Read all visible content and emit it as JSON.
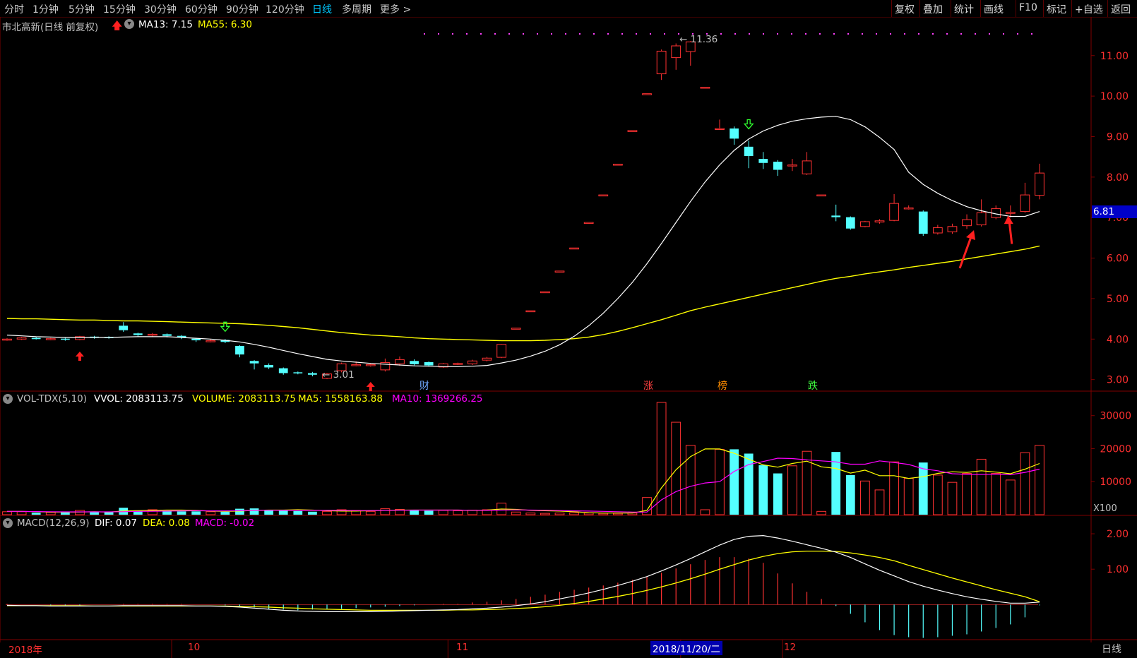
{
  "toolbar": {
    "periods": [
      "分时",
      "1分钟",
      "5分钟",
      "15分钟",
      "30分钟",
      "60分钟",
      "90分钟",
      "120分钟",
      "日线",
      "多周期",
      "更多 >"
    ],
    "active_period": "日线",
    "tools": [
      "复权",
      "叠加",
      "统计",
      "画线",
      "F10",
      "标记",
      "+自选",
      "返回"
    ]
  },
  "colors": {
    "up": "#ff3232",
    "down": "#54ffff",
    "ma13": "#ffffff",
    "ma55": "#ffff00",
    "ma10": "#ff00ff",
    "grid": "#7f0000",
    "price_box": "#0000c8"
  },
  "main_header": {
    "stock": "市北高新(日线 前复权)",
    "ma13_label": "MA13: 7.15",
    "ma55_label": "MA55: 6.30"
  },
  "vol_header": {
    "name": "VOL-TDX(5,10)",
    "vvol": "VVOL: 2083113.75",
    "volume": "VOLUME: 2083113.75",
    "ma5": "MA5: 1558163.88",
    "ma10": "MA10: 1369266.25",
    "unit": "X100"
  },
  "macd_header": {
    "name": "MACD(12,26,9)",
    "dif": "DIF: 0.07",
    "dea": "DEA: 0.08",
    "macd": "MACD: -0.02"
  },
  "annotations": {
    "high": "11.36",
    "low": "3.01",
    "current_price": "6.81"
  },
  "events": [
    "财",
    "涨",
    "榜",
    "跌"
  ],
  "bottom_axis": {
    "labels": [
      "2018年",
      "10",
      "11",
      "2018/11/20/二",
      "12"
    ],
    "period": "日线"
  },
  "chart_data": [
    {
      "type": "candlestick",
      "title": "市北高新(日线 前复权)",
      "y_ticks": [
        "11.00",
        "10.00",
        "9.00",
        "8.00",
        "7.00",
        "6.00",
        "5.00",
        "4.00",
        "3.00"
      ],
      "ylim": [
        2.75,
        11.85
      ],
      "candles": [
        [
          3.98,
          4.0,
          3.96,
          4.02
        ],
        [
          4.0,
          4.03,
          3.98,
          4.05
        ],
        [
          4.03,
          4.0,
          3.99,
          4.05
        ],
        [
          4.0,
          4.01,
          3.97,
          4.03
        ],
        [
          4.01,
          3.99,
          3.96,
          4.03
        ],
        [
          3.99,
          4.06,
          3.97,
          4.08
        ],
        [
          4.06,
          4.05,
          4.01,
          4.08
        ],
        [
          4.05,
          4.04,
          4.01,
          4.07
        ],
        [
          4.33,
          4.22,
          4.18,
          4.42
        ],
        [
          4.14,
          4.1,
          4.05,
          4.16
        ],
        [
          4.1,
          4.12,
          4.06,
          4.15
        ],
        [
          4.12,
          4.08,
          4.04,
          4.14
        ],
        [
          4.08,
          4.04,
          4.0,
          4.1
        ],
        [
          4.01,
          3.97,
          3.93,
          4.03
        ],
        [
          3.94,
          3.96,
          3.92,
          4.0
        ],
        [
          3.98,
          3.93,
          3.9,
          4.0
        ],
        [
          3.83,
          3.62,
          3.55,
          3.85
        ],
        [
          3.46,
          3.4,
          3.25,
          3.48
        ],
        [
          3.36,
          3.3,
          3.26,
          3.4
        ],
        [
          3.28,
          3.16,
          3.12,
          3.3
        ],
        [
          3.18,
          3.17,
          3.13,
          3.2
        ],
        [
          3.16,
          3.12,
          3.08,
          3.19
        ],
        [
          3.03,
          3.14,
          3.01,
          3.16
        ],
        [
          3.22,
          3.39,
          3.18,
          3.42
        ],
        [
          3.36,
          3.37,
          3.33,
          3.45
        ],
        [
          3.35,
          3.37,
          3.32,
          3.39
        ],
        [
          3.24,
          3.42,
          3.2,
          3.52
        ],
        [
          3.39,
          3.49,
          3.34,
          3.57
        ],
        [
          3.46,
          3.38,
          3.35,
          3.5
        ],
        [
          3.43,
          3.35,
          3.32,
          3.45
        ],
        [
          3.31,
          3.39,
          3.29,
          3.41
        ],
        [
          3.38,
          3.4,
          3.36,
          3.42
        ],
        [
          3.39,
          3.46,
          3.36,
          3.49
        ],
        [
          3.48,
          3.53,
          3.45,
          3.56
        ],
        [
          3.55,
          3.87,
          3.53,
          3.88
        ],
        [
          4.27,
          4.27,
          4.27,
          4.27
        ],
        [
          4.7,
          4.7,
          4.7,
          4.7
        ],
        [
          5.17,
          5.17,
          5.17,
          5.17
        ],
        [
          5.68,
          5.68,
          5.68,
          5.68
        ],
        [
          6.25,
          6.25,
          6.25,
          6.25
        ],
        [
          6.88,
          6.88,
          6.88,
          6.88
        ],
        [
          7.56,
          7.56,
          7.56,
          7.56
        ],
        [
          8.32,
          8.32,
          8.32,
          8.32
        ],
        [
          9.15,
          9.15,
          9.15,
          9.15
        ],
        [
          10.06,
          10.06,
          10.06,
          10.06
        ],
        [
          10.55,
          11.11,
          10.4,
          11.15
        ],
        [
          10.95,
          11.24,
          10.65,
          11.3
        ],
        [
          11.1,
          11.34,
          10.75,
          11.36
        ],
        [
          10.22,
          10.22,
          10.22,
          10.22
        ],
        [
          9.2,
          9.2,
          9.2,
          9.42
        ],
        [
          9.2,
          8.95,
          8.8,
          9.25
        ],
        [
          8.75,
          8.52,
          8.22,
          8.9
        ],
        [
          8.45,
          8.35,
          8.2,
          8.62
        ],
        [
          8.38,
          8.18,
          8.03,
          8.42
        ],
        [
          8.3,
          8.3,
          8.15,
          8.45
        ],
        [
          8.08,
          8.4,
          8.05,
          8.62
        ],
        [
          7.56,
          7.56,
          7.56,
          7.56
        ],
        [
          7.05,
          7.01,
          6.91,
          7.32
        ],
        [
          7.01,
          6.73,
          6.7,
          7.03
        ],
        [
          6.78,
          6.9,
          6.76,
          6.92
        ],
        [
          6.89,
          6.92,
          6.85,
          6.96
        ],
        [
          6.93,
          7.35,
          6.91,
          7.58
        ],
        [
          7.22,
          7.24,
          7.2,
          7.3
        ],
        [
          7.15,
          6.6,
          6.55,
          7.18
        ],
        [
          6.62,
          6.75,
          6.58,
          6.82
        ],
        [
          6.65,
          6.78,
          6.6,
          6.85
        ],
        [
          6.8,
          6.95,
          6.72,
          7.08
        ],
        [
          6.82,
          7.12,
          6.78,
          7.45
        ],
        [
          7.0,
          7.22,
          6.96,
          7.3
        ],
        [
          7.11,
          7.13,
          7.0,
          7.3
        ],
        [
          7.15,
          7.56,
          7.12,
          7.86
        ],
        [
          7.55,
          8.1,
          7.45,
          8.33
        ]
      ],
      "ma13": [
        4.1,
        4.08,
        4.06,
        4.05,
        4.04,
        4.04,
        4.04,
        4.04,
        4.05,
        4.06,
        4.06,
        4.06,
        4.04,
        4.02,
        4.0,
        3.97,
        3.93,
        3.87,
        3.8,
        3.72,
        3.64,
        3.57,
        3.5,
        3.46,
        3.43,
        3.4,
        3.38,
        3.36,
        3.34,
        3.33,
        3.32,
        3.32,
        3.33,
        3.35,
        3.41,
        3.48,
        3.58,
        3.7,
        3.86,
        4.07,
        4.33,
        4.64,
        5.0,
        5.4,
        5.86,
        6.36,
        6.88,
        7.4,
        7.88,
        8.3,
        8.66,
        8.94,
        9.14,
        9.28,
        9.38,
        9.44,
        9.48,
        9.5,
        9.42,
        9.24,
        8.98,
        8.68,
        8.12,
        7.82,
        7.6,
        7.42,
        7.27,
        7.17,
        7.09,
        7.03,
        7.03,
        7.15
      ],
      "ma55": [
        4.51,
        4.5,
        4.5,
        4.49,
        4.48,
        4.47,
        4.47,
        4.46,
        4.45,
        4.45,
        4.44,
        4.43,
        4.42,
        4.41,
        4.4,
        4.39,
        4.38,
        4.36,
        4.34,
        4.31,
        4.28,
        4.24,
        4.2,
        4.16,
        4.13,
        4.1,
        4.08,
        4.06,
        4.03,
        4.01,
        4.0,
        3.99,
        3.98,
        3.97,
        3.96,
        3.96,
        3.96,
        3.97,
        3.99,
        4.01,
        4.05,
        4.11,
        4.19,
        4.28,
        4.38,
        4.48,
        4.59,
        4.7,
        4.79,
        4.87,
        4.95,
        5.03,
        5.11,
        5.19,
        5.27,
        5.35,
        5.43,
        5.5,
        5.55,
        5.61,
        5.66,
        5.71,
        5.77,
        5.82,
        5.87,
        5.92,
        5.98,
        6.04,
        6.1,
        6.16,
        6.22,
        6.3
      ],
      "high_marker": 11.36,
      "low_marker": 3.01,
      "current_price": 6.81
    },
    {
      "type": "bar",
      "title": "VOL-TDX(5,10)",
      "unit": "X100",
      "y_ticks": [
        "30000",
        "20000",
        "10000"
      ],
      "ylim": [
        0,
        34000
      ],
      "values": [
        900,
        900,
        600,
        700,
        700,
        1300,
        900,
        800,
        2100,
        1300,
        1500,
        1200,
        1000,
        1000,
        900,
        900,
        1800,
        1900,
        1300,
        1200,
        1100,
        900,
        1000,
        1500,
        1300,
        1000,
        1800,
        1600,
        1300,
        1200,
        1300,
        1200,
        1400,
        1500,
        3500,
        800,
        500,
        400,
        500,
        600,
        500,
        400,
        400,
        500,
        5200,
        34000,
        28000,
        21000,
        1500,
        19800,
        19800,
        18500,
        15000,
        12500,
        14800,
        19200,
        1000,
        19000,
        12000,
        10200,
        7500,
        16000,
        11000,
        15800,
        12000,
        9800,
        12500,
        16800,
        12500,
        10500,
        18800,
        21000
      ],
      "ma5": [
        1000,
        1000,
        900,
        800,
        800,
        800,
        900,
        800,
        1100,
        1200,
        1300,
        1400,
        1400,
        1300,
        1100,
        1000,
        1100,
        1300,
        1400,
        1400,
        1500,
        1400,
        1200,
        1100,
        1100,
        1200,
        1300,
        1400,
        1400,
        1400,
        1400,
        1400,
        1300,
        1400,
        1700,
        1600,
        1300,
        1200,
        1100,
        900,
        600,
        500,
        500,
        500,
        1300,
        8100,
        13600,
        17600,
        19900,
        19900,
        18600,
        16800,
        15100,
        14400,
        15500,
        16200,
        14500,
        14000,
        12600,
        13500,
        11800,
        11800,
        11000,
        11500,
        12500,
        13000,
        12800,
        13300,
        12900,
        12400,
        13800,
        15500
      ],
      "ma10": [
        1000,
        1000,
        950,
        900,
        850,
        850,
        850,
        850,
        900,
        1000,
        1050,
        1100,
        1150,
        1200,
        1150,
        1150,
        1200,
        1300,
        1350,
        1300,
        1300,
        1300,
        1300,
        1300,
        1250,
        1250,
        1300,
        1350,
        1400,
        1400,
        1400,
        1400,
        1350,
        1300,
        1400,
        1450,
        1400,
        1350,
        1250,
        1150,
        1100,
        1000,
        900,
        800,
        800,
        4500,
        7000,
        8600,
        9600,
        10000,
        13100,
        15200,
        16100,
        17100,
        17000,
        16600,
        16300,
        16000,
        15300,
        15300,
        16300,
        15800,
        15200,
        13900,
        13300,
        12400,
        12200,
        12200,
        12300,
        12100,
        12800,
        13800
      ]
    },
    {
      "type": "line",
      "title": "MACD(12,26,9)",
      "y_ticks": [
        "2.00",
        "1.00"
      ],
      "ylim": [
        -0.95,
        2.28
      ],
      "dif": [
        -0.02,
        -0.03,
        -0.03,
        -0.04,
        -0.04,
        -0.04,
        -0.04,
        -0.04,
        -0.03,
        -0.03,
        -0.03,
        -0.03,
        -0.03,
        -0.04,
        -0.04,
        -0.05,
        -0.07,
        -0.1,
        -0.13,
        -0.16,
        -0.18,
        -0.19,
        -0.2,
        -0.2,
        -0.2,
        -0.2,
        -0.19,
        -0.18,
        -0.17,
        -0.16,
        -0.15,
        -0.14,
        -0.12,
        -0.1,
        -0.07,
        -0.03,
        0.02,
        0.08,
        0.16,
        0.24,
        0.33,
        0.43,
        0.54,
        0.66,
        0.79,
        0.95,
        1.12,
        1.3,
        1.49,
        1.68,
        1.84,
        1.93,
        1.95,
        1.88,
        1.79,
        1.69,
        1.59,
        1.48,
        1.33,
        1.15,
        0.97,
        0.81,
        0.65,
        0.52,
        0.41,
        0.31,
        0.22,
        0.15,
        0.09,
        0.04,
        0.04,
        0.07
      ],
      "dea": [
        -0.03,
        -0.03,
        -0.03,
        -0.03,
        -0.03,
        -0.03,
        -0.04,
        -0.04,
        -0.04,
        -0.04,
        -0.04,
        -0.04,
        -0.04,
        -0.04,
        -0.04,
        -0.04,
        -0.05,
        -0.06,
        -0.07,
        -0.09,
        -0.1,
        -0.12,
        -0.13,
        -0.14,
        -0.15,
        -0.16,
        -0.16,
        -0.16,
        -0.16,
        -0.16,
        -0.16,
        -0.15,
        -0.15,
        -0.14,
        -0.13,
        -0.11,
        -0.09,
        -0.06,
        -0.02,
        0.03,
        0.09,
        0.16,
        0.23,
        0.31,
        0.4,
        0.5,
        0.61,
        0.73,
        0.86,
        1.0,
        1.13,
        1.26,
        1.36,
        1.44,
        1.49,
        1.51,
        1.51,
        1.5,
        1.46,
        1.4,
        1.33,
        1.24,
        1.11,
        0.99,
        0.87,
        0.75,
        0.64,
        0.53,
        0.42,
        0.32,
        0.22,
        0.08
      ],
      "macd_bar": [
        0.02,
        0.0,
        0.0,
        -0.02,
        -0.02,
        -0.02,
        0.0,
        0.0,
        0.02,
        0.02,
        0.02,
        0.02,
        0.02,
        0.0,
        0.0,
        -0.02,
        -0.04,
        -0.08,
        -0.12,
        -0.14,
        -0.16,
        -0.14,
        -0.14,
        -0.12,
        -0.1,
        -0.08,
        -0.06,
        -0.04,
        -0.02,
        0.0,
        0.02,
        0.02,
        0.06,
        0.08,
        0.12,
        0.16,
        0.22,
        0.28,
        0.36,
        0.42,
        0.48,
        0.54,
        0.62,
        0.7,
        0.78,
        0.9,
        1.02,
        1.14,
        1.26,
        1.34,
        1.34,
        1.3,
        1.18,
        0.88,
        0.6,
        0.36,
        0.16,
        -0.04,
        -0.26,
        -0.5,
        -0.72,
        -0.86,
        -0.92,
        -0.94,
        -0.92,
        -0.88,
        -0.84,
        -0.76,
        -0.66,
        -0.56,
        -0.36,
        -0.02
      ]
    }
  ]
}
